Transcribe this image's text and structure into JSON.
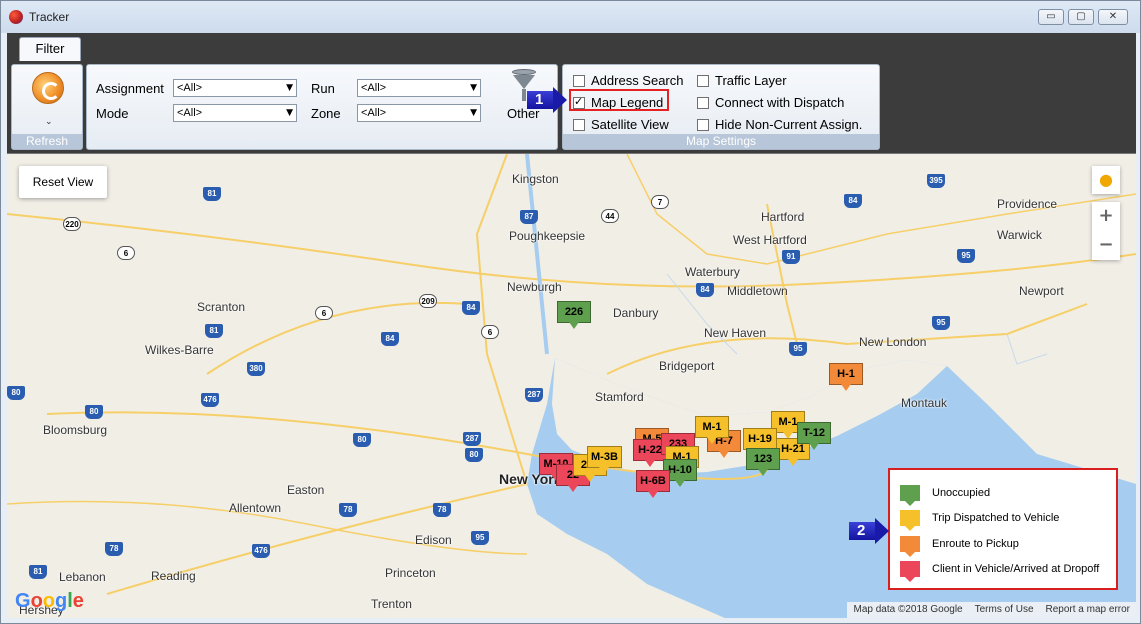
{
  "window": {
    "title": "Tracker",
    "controls": [
      "▭",
      "▢",
      "✕"
    ]
  },
  "tabs": {
    "filter": "Filter"
  },
  "ribbon": {
    "refresh_group_label": "Refresh",
    "assignment_label": "Assignment",
    "assignment_value": "<All>",
    "mode_label": "Mode",
    "mode_value": "<All>",
    "run_label": "Run",
    "run_value": "<All>",
    "zone_label": "Zone",
    "zone_value": "<All>",
    "other_label": "Other",
    "map_settings_label": "Map Settings",
    "address_search": "Address Search",
    "map_legend": "Map Legend",
    "map_legend_checked": true,
    "satellite_view": "Satellite View",
    "traffic_layer": "Traffic Layer",
    "connect_dispatch": "Connect with Dispatch",
    "hide_noncurrent": "Hide Non-Current Assign."
  },
  "callouts": {
    "one": "1",
    "two": "2"
  },
  "map": {
    "reset_view": "Reset View",
    "zoom_in": "+",
    "zoom_out": "−",
    "places": {
      "kingston": "Kingston",
      "hartford": "Hartford",
      "west_hartford": "West Hartford",
      "providence": "Providence",
      "warwick": "Warwick",
      "poughkeepsie": "Poughkeepsie",
      "waterbury": "Waterbury",
      "middletown": "Middletown",
      "newport": "Newport",
      "scranton": "Scranton",
      "newburgh": "Newburgh",
      "danbury": "Danbury",
      "new_haven": "New Haven",
      "new_london": "New London",
      "wilkes_barre": "Wilkes-Barre",
      "bridgeport": "Bridgeport",
      "stamford": "Stamford",
      "montauk": "Montauk",
      "bloomsburg": "Bloomsburg",
      "new_york": "New York",
      "easton": "Easton",
      "allentown": "Allentown",
      "edison": "Edison",
      "lebanon": "Lebanon",
      "reading": "Reading",
      "princeton": "Princeton",
      "trenton": "Trenton",
      "hershey": "Hershey"
    },
    "markers": [
      {
        "label": "226",
        "status": "green"
      },
      {
        "label": "H-1",
        "status": "orange"
      },
      {
        "label": "M-1",
        "status": "yellow"
      },
      {
        "label": "H-19",
        "status": "yellow"
      },
      {
        "label": "H-21",
        "status": "yellow"
      },
      {
        "label": "T-12",
        "status": "green"
      },
      {
        "label": "H-7",
        "status": "orange"
      },
      {
        "label": "M-1",
        "status": "yellow"
      },
      {
        "label": "123",
        "status": "green"
      },
      {
        "label": "M-5",
        "status": "orange"
      },
      {
        "label": "H-22",
        "status": "red"
      },
      {
        "label": "233",
        "status": "red"
      },
      {
        "label": "M-1",
        "status": "yellow"
      },
      {
        "label": "H-10",
        "status": "green"
      },
      {
        "label": "H-6B",
        "status": "red"
      },
      {
        "label": "M-10",
        "status": "red"
      },
      {
        "label": "22",
        "status": "red"
      },
      {
        "label": "224",
        "status": "yellow"
      },
      {
        "label": "M-3B",
        "status": "yellow"
      }
    ],
    "google": "Google",
    "attribution": {
      "data": "Map data ©2018 Google",
      "terms": "Terms of Use",
      "report": "Report a map error"
    }
  },
  "legend": {
    "items": [
      {
        "label": "Unoccupied",
        "color": "#5fa04e"
      },
      {
        "label": "Trip Dispatched to Vehicle",
        "color": "#f5c02a"
      },
      {
        "label": "Enroute to Pickup",
        "color": "#f28a3a"
      },
      {
        "label": "Client in Vehicle/Arrived at Dropoff",
        "color": "#eb4659"
      }
    ]
  }
}
